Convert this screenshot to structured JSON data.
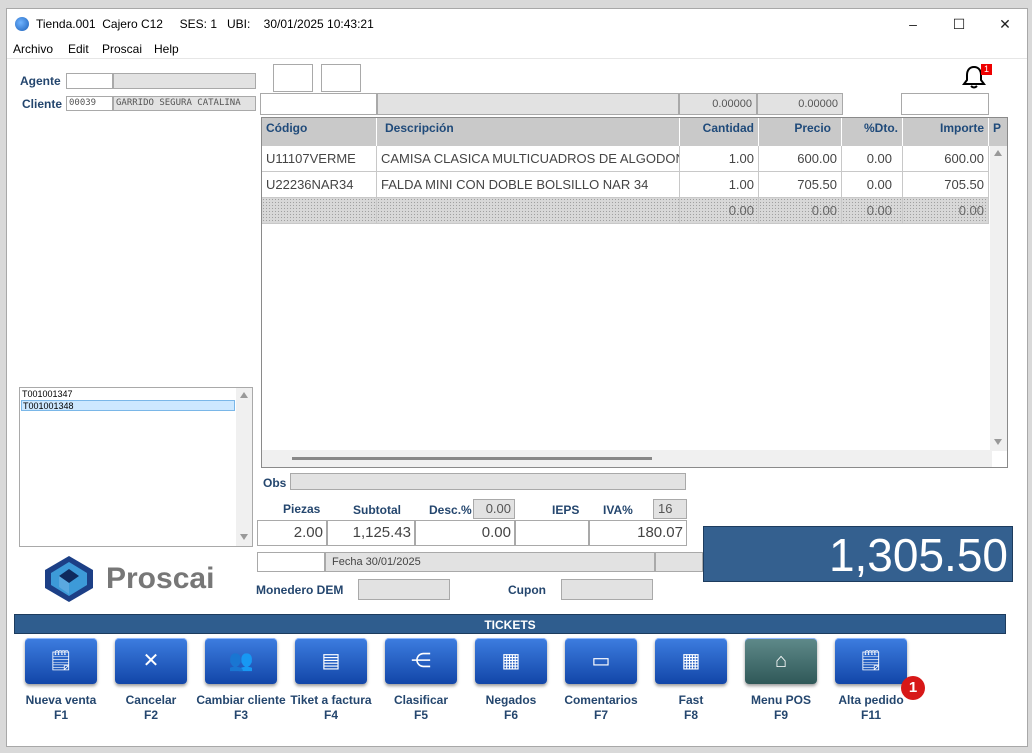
{
  "titlebar": {
    "title": "Tienda.001  Cajero C12     SES: 1   UBI:    30/01/2025 10:43:21",
    "minimize": "–",
    "maximize": "☐",
    "close": "✕"
  },
  "menu": [
    "Archivo",
    "Edit",
    "Proscai",
    "Help"
  ],
  "form": {
    "agente_label": "Agente",
    "cliente_label": "Cliente",
    "cliente_code": "00039",
    "cliente_name": "GARRIDO SEGURA CATALINA"
  },
  "notifications": {
    "count": "1"
  },
  "header_values": {
    "v1": "0.00000",
    "v2": "0.00000"
  },
  "grid": {
    "columns": [
      "Código",
      "Descripción",
      "Cantidad",
      "Precio",
      "%Dto.",
      "Importe",
      "P"
    ],
    "rows": [
      [
        "U11107VERME",
        "CAMISA CLASICA MULTICUADROS DE ALGODON VE",
        "1.00",
        "600.00",
        "0.00",
        "600.00"
      ],
      [
        "U22236NAR34",
        "FALDA MINI CON DOBLE BOLSILLO NAR 34",
        "1.00",
        "705.50",
        "0.00",
        "705.50"
      ],
      [
        "",
        "",
        "0.00",
        "0.00",
        "0.00",
        "0.00"
      ]
    ]
  },
  "tickets_list": [
    "T001001347",
    "T001001348"
  ],
  "brand": {
    "name": "Proscai"
  },
  "totals": {
    "obs_label": "Obs",
    "piezas_label": "Piezas",
    "subtotal_label": "Subtotal",
    "desc_label": "Desc.%",
    "desc_pct": "0.00",
    "ieps_label": "IEPS",
    "iva_label": "IVA%",
    "iva_pct": "16",
    "piezas": "2.00",
    "subtotal": "1,125.43",
    "descuento": "0.00",
    "ieps": "",
    "iva": "180.07",
    "fecha": "Fecha 30/01/2025",
    "monedero_label": "Monedero DEM",
    "cupon_label": "Cupon",
    "grand_total": "1,305.50"
  },
  "tickets_bar": "TICKETS",
  "function_keys": [
    {
      "label": "Nueva venta",
      "key": "F1",
      "icon": "new-sale-icon"
    },
    {
      "label": "Cancelar",
      "key": "F2",
      "icon": "cancel-icon"
    },
    {
      "label": "Cambiar cliente",
      "key": "F3",
      "icon": "users-icon"
    },
    {
      "label": "Tiket a factura",
      "key": "F4",
      "icon": "invoice-icon"
    },
    {
      "label": "Clasificar",
      "key": "F5",
      "icon": "tree-icon"
    },
    {
      "label": "Negados",
      "key": "F6",
      "icon": "grid-icon"
    },
    {
      "label": "Comentarios",
      "key": "F7",
      "icon": "comment-icon"
    },
    {
      "label": "Fast",
      "key": "F8",
      "icon": "list-grid-icon"
    },
    {
      "label": "Menu POS",
      "key": "F9",
      "icon": "home-icon"
    },
    {
      "label": "Alta pedido",
      "key": "F11",
      "icon": "new-order-icon"
    }
  ],
  "alta_pedido_badge": "1"
}
